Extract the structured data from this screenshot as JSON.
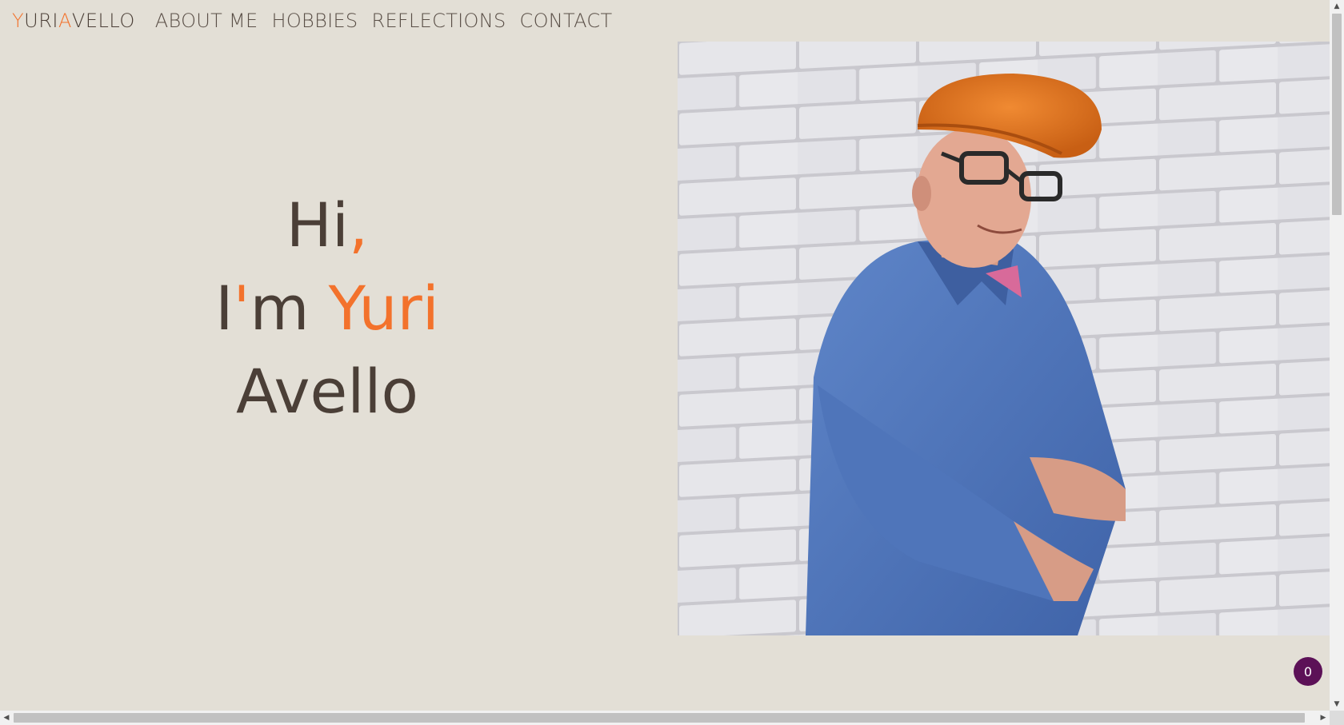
{
  "header": {
    "logo": {
      "part1": "Y",
      "part2": "URI",
      "part3": "A",
      "part4": "VELLO"
    },
    "nav": [
      {
        "label": "ABOUT ME"
      },
      {
        "label": "HOBBIES"
      },
      {
        "label": "REFLECTIONS"
      },
      {
        "label": "CONTACT"
      }
    ]
  },
  "hero": {
    "line1_text": "Hi",
    "line1_punct": ",",
    "line2_i": "I",
    "line2_apos": "'",
    "line2_m": "m ",
    "line2_name": "Yuri",
    "line3": "Avello"
  },
  "badge": {
    "count": "0"
  },
  "colors": {
    "background": "#e3dfd6",
    "text": "#4b3f37",
    "accent": "#f3722c",
    "badge": "#5c1157"
  },
  "icons": {
    "scroll_up": "triangle-up-icon",
    "scroll_down": "triangle-down-icon",
    "scroll_left": "triangle-left-icon",
    "scroll_right": "triangle-right-icon"
  }
}
